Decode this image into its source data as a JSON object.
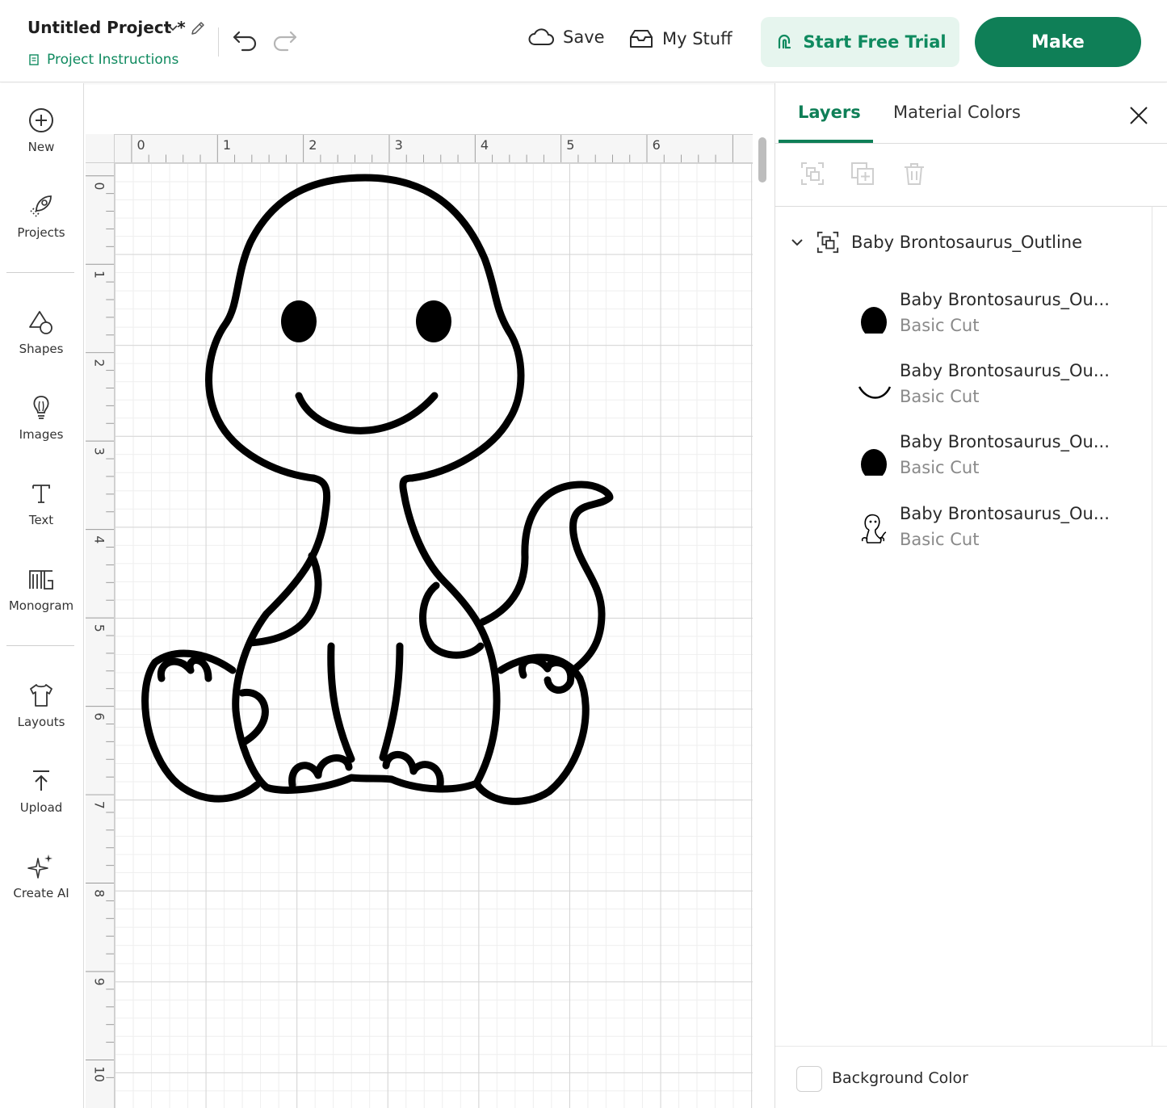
{
  "header": {
    "project_title": "Untitled Project *",
    "project_instructions": "Project Instructions",
    "save_label": "Save",
    "my_stuff_label": "My Stuff",
    "trial_label": "Start Free Trial",
    "make_label": "Make"
  },
  "sidebar": {
    "items": [
      {
        "label": "New",
        "icon": "plus-circle-icon"
      },
      {
        "label": "Projects",
        "icon": "rocket-icon"
      },
      {
        "label": "Shapes",
        "icon": "shapes-icon"
      },
      {
        "label": "Images",
        "icon": "lightbulb-icon"
      },
      {
        "label": "Text",
        "icon": "text-icon"
      },
      {
        "label": "Monogram",
        "icon": "monogram-icon"
      },
      {
        "label": "Layouts",
        "icon": "shirt-icon"
      },
      {
        "label": "Upload",
        "icon": "upload-icon"
      },
      {
        "label": "Create AI",
        "icon": "sparkle-icon"
      }
    ]
  },
  "rulers": {
    "horizontal": [
      "0",
      "1",
      "2",
      "3",
      "4",
      "5",
      "6"
    ],
    "vertical": [
      "0",
      "1",
      "2",
      "3",
      "4",
      "5",
      "6",
      "7",
      "8",
      "9",
      "10"
    ]
  },
  "panel": {
    "tabs": [
      {
        "label": "Layers",
        "active": true
      },
      {
        "label": "Material Colors",
        "active": false
      }
    ],
    "group_name": "Baby Brontosaurus_Outline",
    "layers": [
      {
        "name": "Baby Brontosaurus_Ou...",
        "operation": "Basic Cut",
        "thumb": "eye-dot-icon"
      },
      {
        "name": "Baby Brontosaurus_Ou...",
        "operation": "Basic Cut",
        "thumb": "smile-curve-icon"
      },
      {
        "name": "Baby Brontosaurus_Ou...",
        "operation": "Basic Cut",
        "thumb": "eye-dot-icon"
      },
      {
        "name": "Baby Brontosaurus_Ou...",
        "operation": "Basic Cut",
        "thumb": "dinosaur-outline-icon"
      }
    ],
    "background_color_label": "Background Color"
  },
  "colors": {
    "accent": "#0f7f57",
    "accent_light": "#e6f5ee",
    "link_green": "#0f8a5f"
  }
}
